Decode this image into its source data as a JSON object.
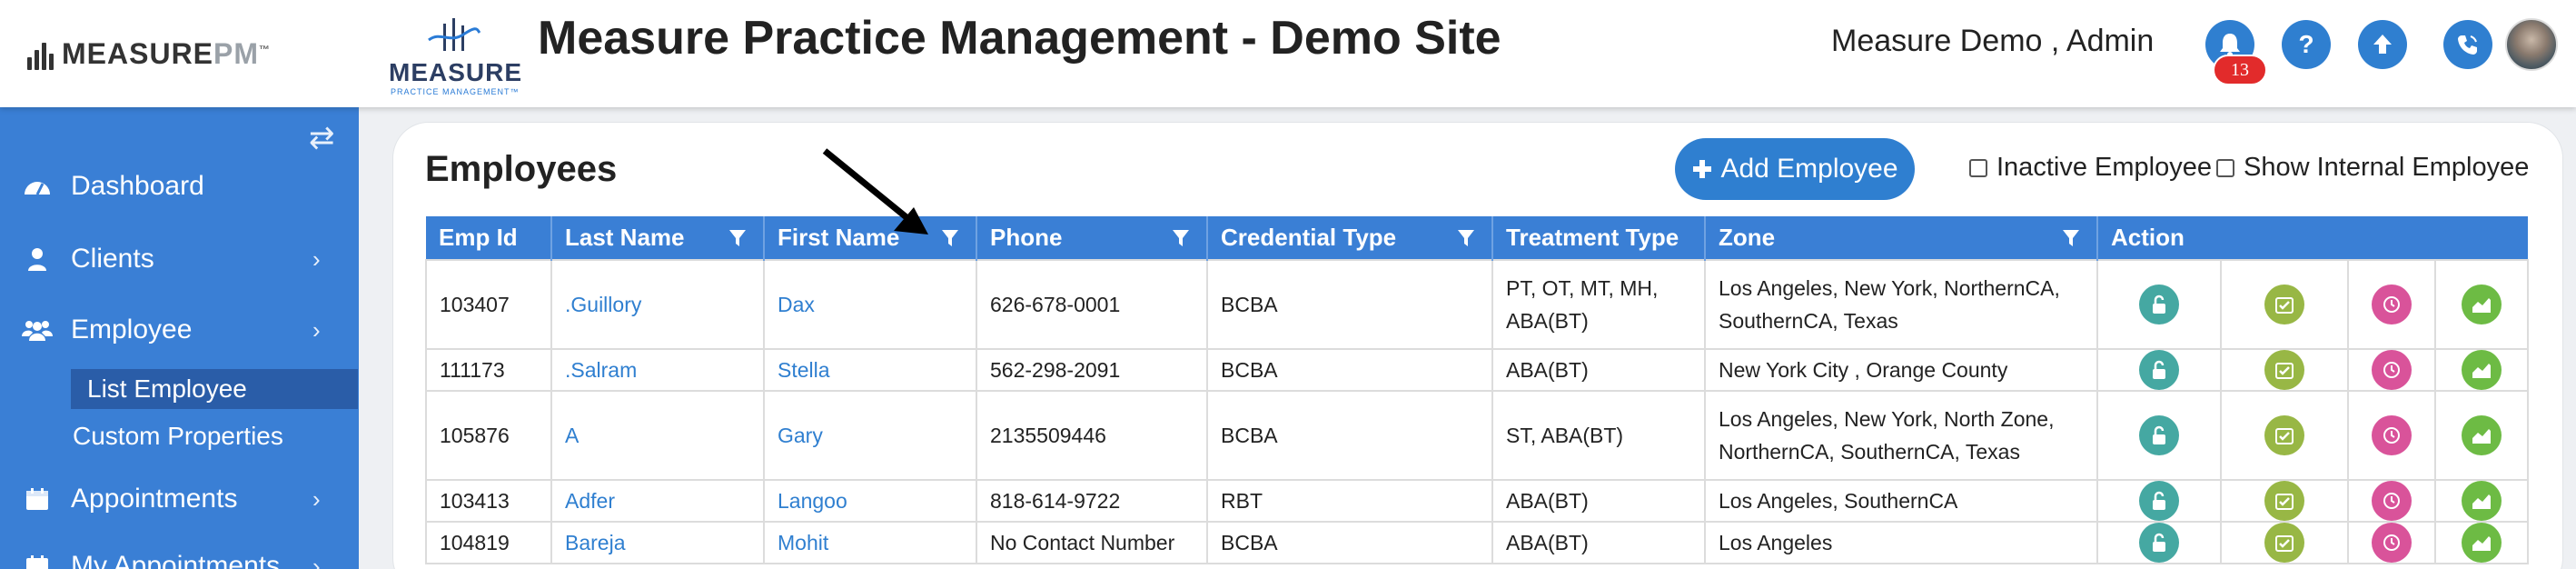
{
  "brand": {
    "name_main": "MEASURE",
    "name_pm": "PM",
    "trademark": "™"
  },
  "logo2": {
    "word": "MEASURE",
    "sub": "PRACTICE MANAGEMENT™"
  },
  "app_title": "Measure Practice Management - Demo Site",
  "user": {
    "name": "Measure Demo , Admin"
  },
  "header_icons": [
    "bell-icon",
    "help-icon",
    "upload-icon",
    "phone-icon"
  ],
  "notifications": {
    "count": "13"
  },
  "sidebar": {
    "items": [
      {
        "label": "Dashboard",
        "icon": "dashboard-icon",
        "has_children": false
      },
      {
        "label": "Clients",
        "icon": "user-icon",
        "has_children": true
      },
      {
        "label": "Employee",
        "icon": "users-icon",
        "has_children": true
      },
      {
        "label": "Appointments",
        "icon": "calendar-icon",
        "has_children": true
      },
      {
        "label": "My Appointments",
        "icon": "calendar-icon",
        "has_children": true
      }
    ],
    "employee_sub": [
      {
        "label": "List Employee",
        "active": true
      },
      {
        "label": "Custom Properties",
        "active": false
      }
    ]
  },
  "page": {
    "title": "Employees",
    "add_button": "Add Employee",
    "checkbox_inactive": "Inactive Employee",
    "checkbox_internal": "Show Internal Employee"
  },
  "table": {
    "headers": [
      {
        "label": "Emp Id",
        "filter": false
      },
      {
        "label": "Last Name",
        "filter": true
      },
      {
        "label": "First Name",
        "filter": true
      },
      {
        "label": "Phone",
        "filter": true
      },
      {
        "label": "Credential Type",
        "filter": true
      },
      {
        "label": "Treatment Type",
        "filter": false
      },
      {
        "label": "Zone",
        "filter": true
      },
      {
        "label": "Action",
        "filter": false
      }
    ],
    "rows": [
      {
        "emp_id": "103407",
        "last_name": ".Guillory",
        "first_name": "Dax",
        "phone": "626-678-0001",
        "credential": "BCBA",
        "treatment": "PT, OT, MT, MH, ABA(BT)",
        "zone": "Los Angeles, New York, NorthernCA, SouthernCA, Texas"
      },
      {
        "emp_id": "111173",
        "last_name": ".Salram",
        "first_name": "Stella",
        "phone": "562-298-2091",
        "credential": "BCBA",
        "treatment": "ABA(BT)",
        "zone": "New York City , Orange County"
      },
      {
        "emp_id": "105876",
        "last_name": "A",
        "first_name": "Gary",
        "phone": "2135509446",
        "credential": "BCBA",
        "treatment": "ST, ABA(BT)",
        "zone": "Los Angeles, New York, North Zone, NorthernCA, SouthernCA, Texas"
      },
      {
        "emp_id": "103413",
        "last_name": "Adfer",
        "first_name": "Langoo",
        "phone": "818-614-9722",
        "credential": "RBT",
        "treatment": "ABA(BT)",
        "zone": "Los Angeles, SouthernCA"
      },
      {
        "emp_id": "104819",
        "last_name": "Bareja",
        "first_name": "Mohit",
        "phone": "No Contact Number",
        "credential": "BCBA",
        "treatment": "ABA(BT)",
        "zone": "Los Angeles"
      }
    ],
    "action_icons": [
      {
        "name": "unlock-icon",
        "color": "#45a8a2"
      },
      {
        "name": "calendar-check-icon",
        "color": "#98b745"
      },
      {
        "name": "clock-icon",
        "color": "#d9539a"
      },
      {
        "name": "chart-icon",
        "color": "#6dbb44"
      }
    ]
  },
  "colors": {
    "primary": "#3a7fd5",
    "sidebar_active": "#2a5da8",
    "badge": "#e22b2b",
    "link": "#2f7fd0"
  }
}
